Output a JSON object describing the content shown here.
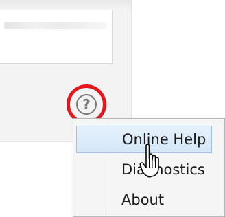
{
  "help": {
    "icon_glyph": "?",
    "icon": "question-circle-icon",
    "highlight_color": "#e8141b"
  },
  "menu": {
    "items": [
      {
        "label": "Online Help",
        "highlighted": true
      },
      {
        "label": "Diagnostics",
        "highlighted": false
      },
      {
        "label": "About",
        "highlighted": false
      }
    ]
  },
  "cursor": {
    "icon": "hand-pointer-icon"
  },
  "colors": {
    "menu_highlight": "#d4e6f8",
    "menu_highlight_border": "#9cc4ea",
    "panel_background": "#f3f3f3"
  }
}
